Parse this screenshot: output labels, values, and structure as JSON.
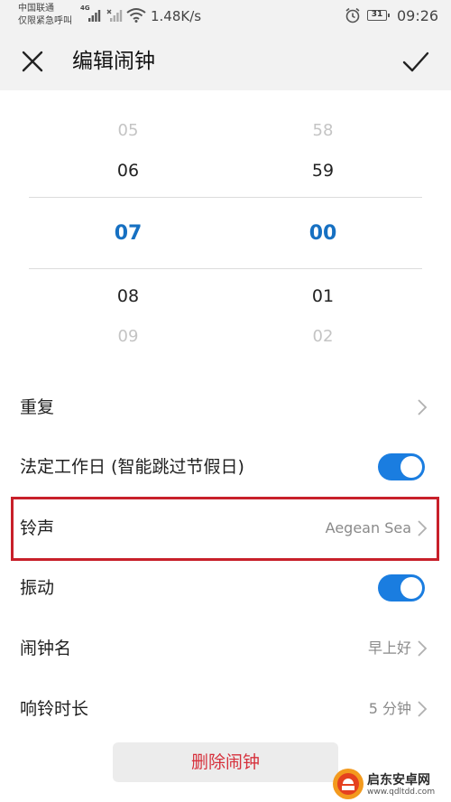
{
  "status_bar": {
    "carrier_line1": "中国联通",
    "carrier_line2": "仅限紧急呼叫",
    "network_label": "4G",
    "network_speed": "1.48K/s",
    "battery_level": "31",
    "time": "09:26",
    "icons": [
      "signal-4g-icon",
      "signal-no-sim-icon",
      "wifi-icon",
      "alarm-clock-icon",
      "battery-icon"
    ]
  },
  "header": {
    "title": "编辑闹钟",
    "icons": [
      "close-icon",
      "check-icon"
    ]
  },
  "time_picker": {
    "hours": [
      "05",
      "06",
      "07",
      "08",
      "09"
    ],
    "minutes": [
      "58",
      "59",
      "00",
      "01",
      "02"
    ],
    "selected_hour": "07",
    "selected_minute": "00"
  },
  "settings": {
    "repeat": {
      "label": "重复"
    },
    "workday": {
      "label": "法定工作日 (智能跳过节假日)",
      "enabled": true
    },
    "ringtone": {
      "label": "铃声",
      "value": "Aegean Sea"
    },
    "vibration": {
      "label": "振动",
      "enabled": true
    },
    "alarm_name": {
      "label": "闹钟名",
      "value": "早上好"
    },
    "ring_duration": {
      "label": "响铃时长",
      "value": "5 分钟"
    }
  },
  "delete_button": {
    "label": "删除闹钟"
  },
  "watermark": {
    "name": "启东安卓网",
    "url": "www.qdltdd.com"
  },
  "colors": {
    "accent": "#1670c2",
    "toggle_on": "#1a7de0",
    "highlight": "#c8202a",
    "danger": "#d6303b",
    "header_bg": "#f2f2f2"
  }
}
